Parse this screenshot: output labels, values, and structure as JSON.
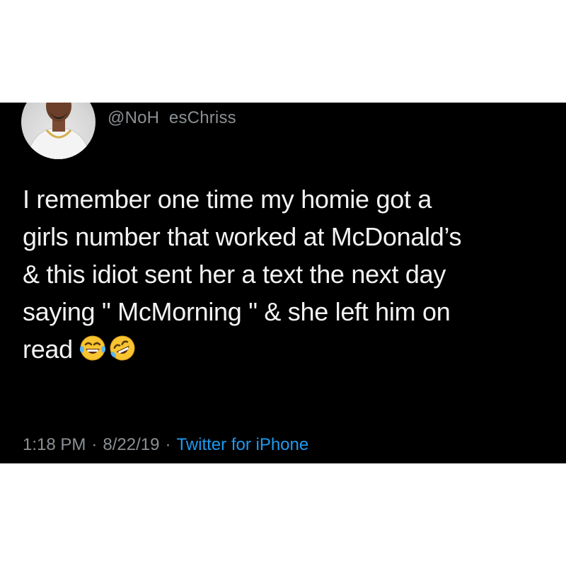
{
  "tweet": {
    "handle": "@NoH  esChriss",
    "text_lines": [
      "I remember one time my homie got a",
      "girls number that worked at McDonald’s",
      "& this idiot sent her a text the next day",
      "saying \" McMorning \" & she left him on",
      "read"
    ],
    "emojis": [
      "tears-of-joy-icon",
      "rolling-on-floor-laughing-icon"
    ],
    "time": "1:18 PM",
    "date": "8/22/19",
    "separator": "·",
    "source": "Twitter for iPhone"
  },
  "colors": {
    "background": "#000000",
    "text": "#f3f3f3",
    "secondary": "#8b9094",
    "link": "#1d9bf0"
  }
}
